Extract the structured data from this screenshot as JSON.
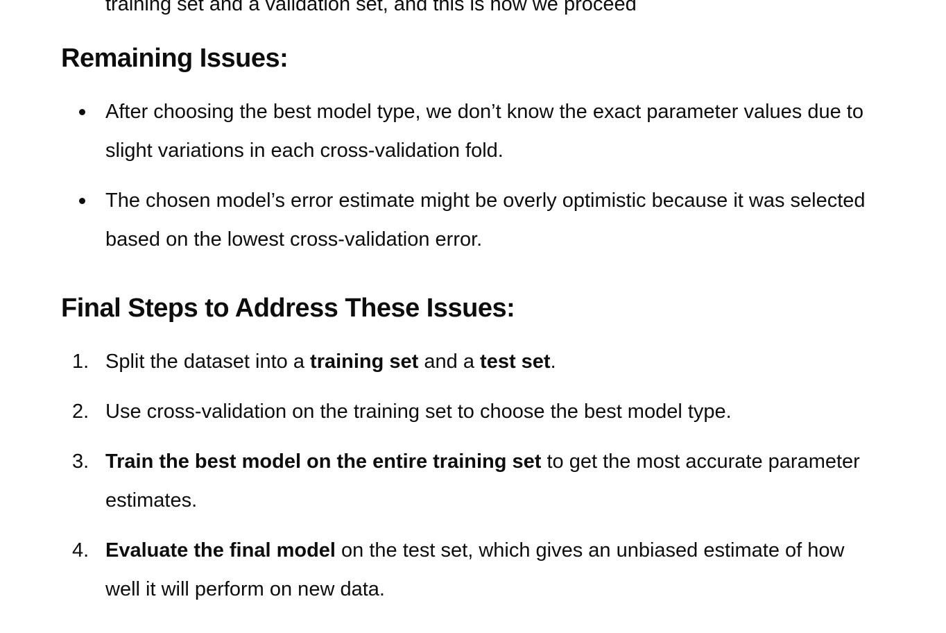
{
  "top_cut_text": "training set and a validation set, and this is how we proceed",
  "remaining": {
    "heading": "Remaining Issues:",
    "items": [
      "After choosing the best model type, we don’t know the exact parameter values due to slight variations in each cross-validation fold.",
      "The chosen model’s error estimate might be overly optimistic because it was selected based on the lowest cross-validation error."
    ]
  },
  "final": {
    "heading": "Final Steps to Address These Issues:",
    "steps": [
      {
        "num": "1.",
        "pre": "Split the dataset into a ",
        "bold1": "training set",
        "mid": " and a ",
        "bold2": "test set",
        "post": "."
      },
      {
        "num": "2.",
        "text": "Use cross-validation on the training set to choose the best model type."
      },
      {
        "num": "3.",
        "bold": "Train the best model on the entire training set",
        "rest": " to get the most accurate parameter estimates."
      },
      {
        "num": "4.",
        "bold": "Evaluate the final model",
        "rest": " on the test set, which gives an unbiased estimate of how well it will perform on new data."
      }
    ]
  }
}
